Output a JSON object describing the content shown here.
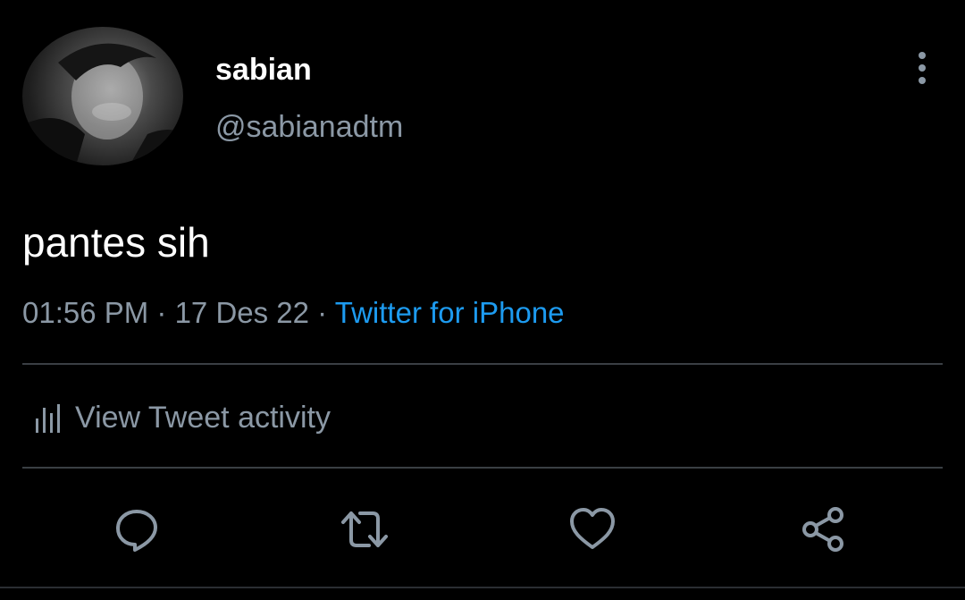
{
  "tweet": {
    "display_name": "sabian",
    "handle": "@sabianadtm",
    "text": "pantes sih",
    "time": "01:56 PM",
    "date": "17 Des 22",
    "separator": " · ",
    "source": "Twitter for iPhone"
  },
  "activity": {
    "label": "View Tweet activity",
    "icon": "bar-chart-icon"
  },
  "actions": [
    {
      "icon": "reply-icon"
    },
    {
      "icon": "retweet-icon"
    },
    {
      "icon": "like-icon"
    },
    {
      "icon": "share-icon"
    }
  ],
  "colors": {
    "background": "#000000",
    "primary_text": "#ffffff",
    "secondary_text": "#8b98a5",
    "link": "#1d9bf0",
    "divider": "#3a3f44"
  }
}
